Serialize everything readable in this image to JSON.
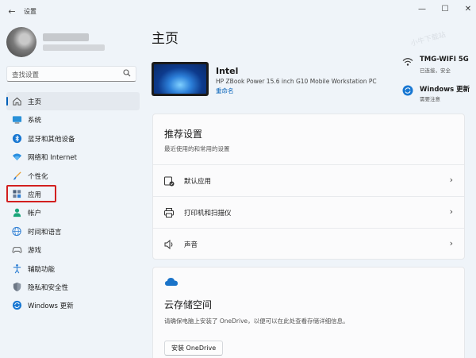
{
  "window": {
    "title": "设置",
    "back_icon": "back-arrow-icon",
    "minimize": "—",
    "maximize": "☐",
    "close": "✕"
  },
  "search": {
    "placeholder": "查找设置",
    "icon": "search-icon"
  },
  "sidebar": {
    "items": [
      {
        "label": "主页",
        "icon": "home-icon",
        "selected": true
      },
      {
        "label": "系统",
        "icon": "monitor-icon"
      },
      {
        "label": "蓝牙和其他设备",
        "icon": "bluetooth-icon"
      },
      {
        "label": "网络和 Internet",
        "icon": "wifi-icon"
      },
      {
        "label": "个性化",
        "icon": "brush-icon"
      },
      {
        "label": "应用",
        "icon": "apps-icon",
        "highlighted": true
      },
      {
        "label": "帐户",
        "icon": "account-icon"
      },
      {
        "label": "时间和语言",
        "icon": "globe-clock-icon"
      },
      {
        "label": "游戏",
        "icon": "gamepad-icon"
      },
      {
        "label": "辅助功能",
        "icon": "accessibility-icon"
      },
      {
        "label": "隐私和安全性",
        "icon": "shield-icon"
      },
      {
        "label": "Windows 更新",
        "icon": "update-icon"
      }
    ],
    "highlight_color": "#d21f1f"
  },
  "main": {
    "title": "主页",
    "watermark": "小牛下载站",
    "device": {
      "name": "Intel",
      "model": "HP ZBook Power 15.6 inch G10 Mobile Workstation PC",
      "rename": "重命名"
    },
    "status": {
      "wifi": {
        "title": "TMG-WIFI 5G",
        "sub": "已连接，安全"
      },
      "update": {
        "title": "Windows 更新",
        "sub": "需要注意"
      }
    },
    "recommended": {
      "title": "推荐设置",
      "subtitle": "最近使用的和常用的设置",
      "rows": [
        {
          "label": "默认应用",
          "icon": "default-apps-icon"
        },
        {
          "label": "打印机和扫描仪",
          "icon": "printer-icon"
        },
        {
          "label": "声音",
          "icon": "speaker-icon"
        }
      ]
    },
    "cloud": {
      "title": "云存储空间",
      "description": "请确保电脑上安装了 OneDrive，以便可以在此处查看存储详细信息。",
      "button": "安装 OneDrive"
    }
  },
  "colors": {
    "accent": "#005fb8",
    "background": "#eff4f9",
    "card": "#fbfbfc"
  }
}
